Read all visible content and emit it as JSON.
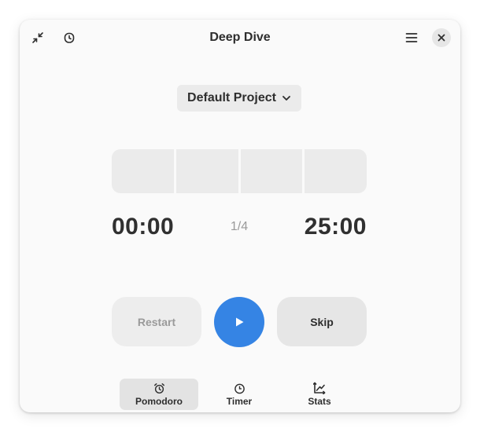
{
  "header": {
    "title": "Deep Dive",
    "icons": [
      "shrink-arrows-icon",
      "timer-icon",
      "hamburger-menu-icon",
      "close-icon"
    ]
  },
  "project": {
    "selected": "Default Project",
    "icon": "chevron-down-icon"
  },
  "timer": {
    "elapsed": "00:00",
    "session_counter": "1/4",
    "total": "25:00",
    "segments": 4,
    "progress": 0
  },
  "controls": {
    "restart_label": "Restart",
    "play_icon": "play-icon",
    "skip_label": "Skip"
  },
  "tabs": [
    {
      "label": "Pomodoro",
      "icon": "alarm-clock-icon",
      "active": true
    },
    {
      "label": "Timer",
      "icon": "stopwatch-icon",
      "active": false
    },
    {
      "label": "Stats",
      "icon": "chart-axes-icon",
      "active": false
    }
  ],
  "colors": {
    "accent": "#3584e4",
    "window_bg": "#fafafa",
    "button_bg": "#e6e6e6",
    "text": "#2e2e2e",
    "muted_text": "#9a9a9a"
  }
}
